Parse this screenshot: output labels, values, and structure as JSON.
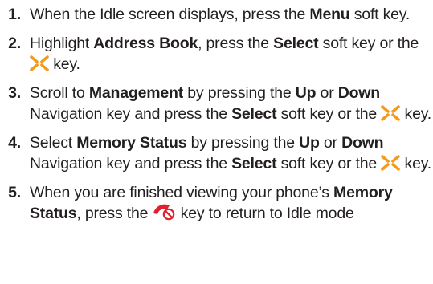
{
  "steps": [
    {
      "number": "1.",
      "parts": [
        {
          "t": "When the Idle screen displays, press the "
        },
        {
          "t": "Menu",
          "b": true
        },
        {
          "t": " soft key."
        }
      ]
    },
    {
      "number": "2.",
      "parts": [
        {
          "t": "Highlight "
        },
        {
          "t": "Address Book",
          "b": true
        },
        {
          "t": ", press the "
        },
        {
          "t": "Select",
          "b": true
        },
        {
          "t": " soft key or the "
        },
        {
          "icon": "ok-nav-key-icon"
        },
        {
          "t": " key."
        }
      ]
    },
    {
      "number": "3.",
      "parts": [
        {
          "t": "Scroll to "
        },
        {
          "t": "Management",
          "b": true
        },
        {
          "t": " by pressing the "
        },
        {
          "t": "Up",
          "b": true
        },
        {
          "t": " or "
        },
        {
          "t": "Down",
          "b": true
        },
        {
          "t": " Navigation key and press the "
        },
        {
          "t": "Select",
          "b": true
        },
        {
          "t": " soft key or the "
        },
        {
          "icon": "ok-nav-key-icon"
        },
        {
          "t": " key."
        }
      ]
    },
    {
      "number": "4.",
      "parts": [
        {
          "t": "Select "
        },
        {
          "t": "Memory Status",
          "b": true
        },
        {
          "t": " by pressing the "
        },
        {
          "t": "Up",
          "b": true
        },
        {
          "t": " or "
        },
        {
          "t": "Down",
          "b": true
        },
        {
          "t": " Navigation key and press the "
        },
        {
          "t": "Select",
          "b": true
        },
        {
          "t": " soft key or the "
        },
        {
          "icon": "ok-nav-key-icon"
        },
        {
          "t": " key."
        }
      ]
    },
    {
      "number": "5.",
      "parts": [
        {
          "t": "When you are finished viewing your phone’s "
        },
        {
          "t": "Memory Status",
          "b": true
        },
        {
          "t": ", press the "
        },
        {
          "icon": "end-call-key-icon"
        },
        {
          "t": " key to return to Idle mode"
        }
      ]
    }
  ],
  "colors": {
    "text": "#231f20",
    "ok_key": "#f39b1c",
    "end_key": "#e31e2d"
  }
}
